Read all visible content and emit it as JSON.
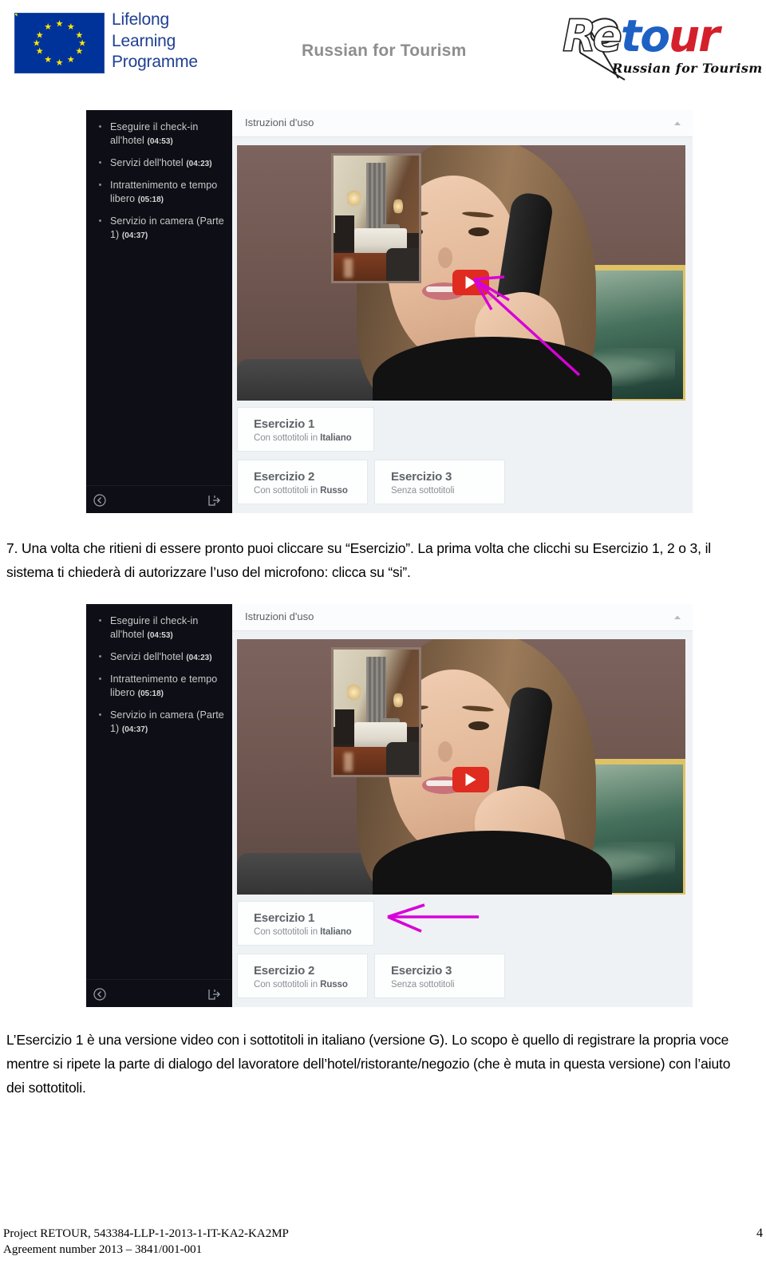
{
  "header": {
    "eu_logo": {
      "line1": "Lifelong",
      "line2": "Learning",
      "line3": "Programme",
      "flag_color": "#003399",
      "star_color": "#FFE800",
      "text_color": "#1F3F93"
    },
    "title": "Russian for Tourism",
    "title_color": "#8E8E8E",
    "retour_logo": {
      "part1": "Re",
      "part2": "to",
      "part3": "ur",
      "tagline": "Russian for Tourism",
      "color_to": "#1D61C4",
      "color_ur": "#D4202B"
    }
  },
  "screenshots": [
    {
      "id": "screenshot-step-7",
      "sidebar": {
        "items": [
          {
            "label": "Eseguire il check-in all'hotel",
            "duration": "(04:53)"
          },
          {
            "label": "Servizi dell'hotel",
            "duration": "(04:23)"
          },
          {
            "label": "Intrattenimento e tempo libero",
            "duration": "(05:18)"
          },
          {
            "label": "Servizio in camera (Parte 1)",
            "duration": "(04:37)"
          }
        ],
        "back_icon": "back-circle-icon",
        "exit_icon": "exit-icon"
      },
      "panel": {
        "header_title": "Istruzioni d'uso",
        "collapse_icon": "chevron-up-icon",
        "video": {
          "play_icon": "play-button-icon",
          "play_color": "#E02B20",
          "thumbnail_alt": "hotel-room-thumbnail"
        },
        "exercises": [
          {
            "title": "Esercizio 1",
            "sub_prefix": "Con sottotitoli in ",
            "sub_strong": "Italiano"
          },
          {
            "title": "Esercizio 2",
            "sub_prefix": "Con sottotitoli in ",
            "sub_strong": "Russo"
          },
          {
            "title": "Esercizio 3",
            "sub_prefix": "Senza sottotitoli",
            "sub_strong": ""
          }
        ]
      },
      "annotation": {
        "type": "arrow",
        "color": "#D800D8",
        "points_to": "play-button-icon"
      }
    },
    {
      "id": "screenshot-esercizio-1",
      "sidebar": {
        "items": [
          {
            "label": "Eseguire il check-in all'hotel",
            "duration": "(04:53)"
          },
          {
            "label": "Servizi dell'hotel",
            "duration": "(04:23)"
          },
          {
            "label": "Intrattenimento e tempo libero",
            "duration": "(05:18)"
          },
          {
            "label": "Servizio in camera (Parte 1)",
            "duration": "(04:37)"
          }
        ],
        "back_icon": "back-circle-icon",
        "exit_icon": "exit-icon"
      },
      "panel": {
        "header_title": "Istruzioni d'uso",
        "collapse_icon": "chevron-up-icon",
        "video": {
          "play_icon": "play-button-icon",
          "play_color": "#E02B20",
          "thumbnail_alt": "hotel-room-thumbnail"
        },
        "exercises": [
          {
            "title": "Esercizio 1",
            "sub_prefix": "Con sottotitoli in ",
            "sub_strong": "Italiano"
          },
          {
            "title": "Esercizio 2",
            "sub_prefix": "Con sottotitoli in ",
            "sub_strong": "Russo"
          },
          {
            "title": "Esercizio 3",
            "sub_prefix": "Senza sottotitoli",
            "sub_strong": ""
          }
        ]
      },
      "annotation": {
        "type": "arrow",
        "color": "#D800D8",
        "points_to": "esercizio-1-card"
      }
    }
  ],
  "body": {
    "paragraph_top": "7. Una volta che ritieni di essere pronto puoi cliccare su “Esercizio”. La prima volta che clicchi su Esercizio 1, 2 o 3, il sistema ti chiederà di autorizzare  l’uso del microfono: clicca su “si”.",
    "paragraph_bottom": "L’Esercizio 1 è una versione video con i sottotitoli in italiano (versione G). Lo scopo è quello di registrare la propria voce mentre si ripete la parte di dialogo del lavoratore dell’hotel/ristorante/negozio (che è muta in questa versione) con l’aiuto dei sottotitoli."
  },
  "footer": {
    "line1": "Project RETOUR, 543384-LLP-1-2013-1-IT-KA2-KA2MP",
    "line2": "Agreement number 2013 – 3841/001-001",
    "page_number": "4"
  }
}
